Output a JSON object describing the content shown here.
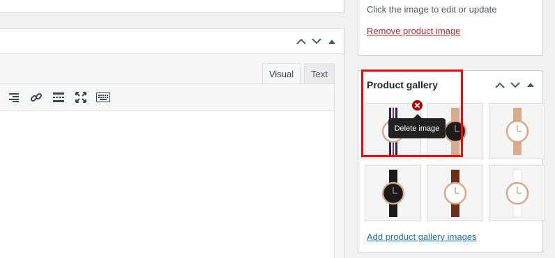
{
  "left_panel": {
    "tabs": [
      {
        "label": "Visual",
        "active": true
      },
      {
        "label": "Text",
        "active": false
      }
    ],
    "toolbar_icons": [
      "align-right-icon",
      "link-icon",
      "read-more-icon",
      "fullscreen-icon",
      "keyboard-icon"
    ]
  },
  "featured_image": {
    "hint": "Click the image to edit or update",
    "remove_label": "Remove product image"
  },
  "gallery": {
    "title": "Product gallery",
    "tooltip": "Delete image",
    "add_label": "Add product gallery images",
    "images": [
      {
        "strap": "striped red white blue",
        "face": "white",
        "case": "rose-gold"
      },
      {
        "strap": "rose-gold mesh",
        "face": "black",
        "case": "rose-gold"
      },
      {
        "strap": "rose-gold mesh",
        "face": "white",
        "case": "rose-gold"
      },
      {
        "strap": "black leather",
        "face": "black",
        "case": "rose-gold"
      },
      {
        "strap": "brown leather",
        "face": "white",
        "case": "rose-gold"
      },
      {
        "strap": "white leather",
        "face": "white",
        "case": "rose-gold"
      }
    ]
  },
  "colors": {
    "link": "#2271b1",
    "danger": "#b32d2e",
    "highlight": "#ff0000"
  }
}
